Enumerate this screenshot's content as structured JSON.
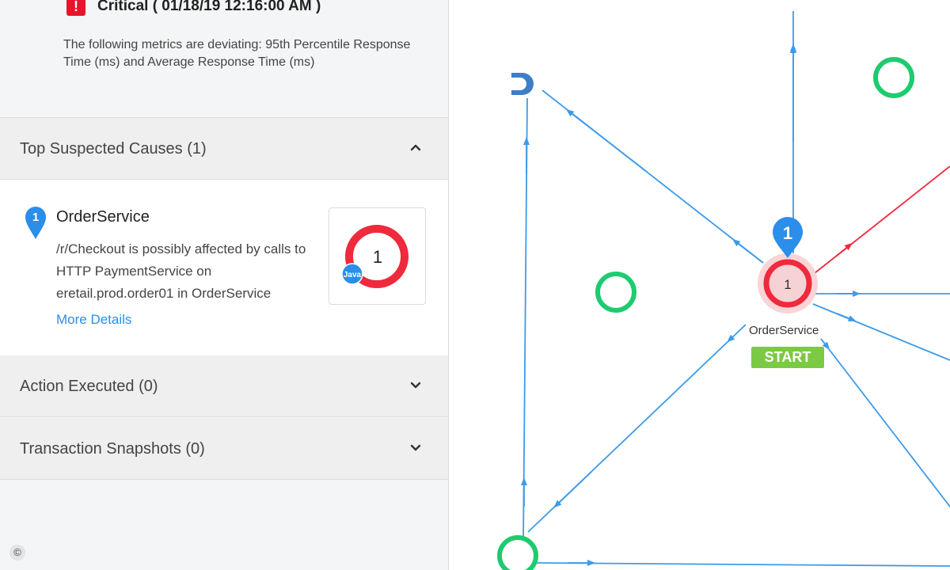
{
  "event": {
    "severity_icon": "exclamation-icon",
    "title": "Critical ( 01/18/19 12:16:00 AM )",
    "description": "The following metrics are deviating: 95th Percentile Response Time (ms) and Average Response Time (ms)"
  },
  "sections": {
    "causes": {
      "title": "Top Suspected Causes (1)",
      "expanded": true
    },
    "actions": {
      "title": "Action Executed (0)",
      "expanded": false
    },
    "snapshots": {
      "title": "Transaction Snapshots (0)",
      "expanded": false
    }
  },
  "cause": {
    "rank": "1",
    "tier": "OrderService",
    "description": "/r/Checkout is possibly affected by calls to HTTP PaymentService on eretail.prod.order01 in OrderService",
    "more_link": "More Details",
    "donut_count": "1",
    "agent_badge": "Java"
  },
  "copyright_symbol": "©",
  "map": {
    "start_node": {
      "label": "OrderService",
      "count": "1",
      "pin": "1",
      "badge": "START"
    }
  },
  "colors": {
    "critical": "#e8132a",
    "link_blue": "#2b8ee8",
    "edge_blue": "#3d9be9",
    "edge_red": "#ee2a3c",
    "node_green": "#1ecb6e",
    "start_green": "#7cc943"
  }
}
